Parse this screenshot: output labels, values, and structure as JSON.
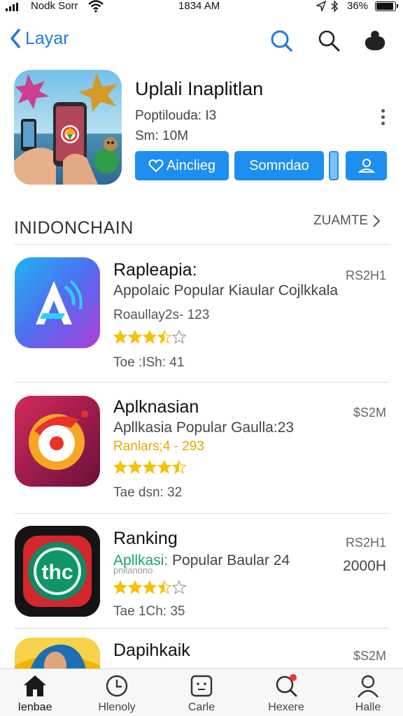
{
  "status_bar": {
    "carrier": "Nodk Sorr",
    "time": "1834 AM",
    "battery": "36%",
    "battery_level": 0.85
  },
  "nav": {
    "back_label": "Layar",
    "icons": [
      "search-icon",
      "search-icon",
      "profile-blob-icon"
    ]
  },
  "featured": {
    "title": "Uplali Inaplitlan",
    "subtitle": "Poptilouda: I3",
    "size": "Sm: 10M",
    "install_label": "Ainclieg",
    "download_label": "Somndao",
    "icon": "user-icon"
  },
  "section": {
    "title": "INIDONCHAIN",
    "see_all": "ZUAMTE"
  },
  "apps": [
    {
      "name": "Rapleapia:",
      "desc": "Appolaic Popular Kiaular Cojlkkala",
      "rank": "Roaullay2s- 123",
      "rank_color": "mixed",
      "rating": 3.5,
      "price": "RS2H1",
      "meta": "Toe :ISh: 41"
    },
    {
      "name": "Aplknasian",
      "desc": "Apllkasia Popular Gaulla:23",
      "rank": "Ranlars;4 - 293",
      "rank_color": "yellow",
      "rating": 4.5,
      "price": "$S2M",
      "meta": "Tae dsn: 32"
    },
    {
      "name": "Ranking",
      "desc_highlight": "Apllkasi:",
      "desc": "Popular Baular 24",
      "desc_sub": "pnilanono",
      "rating": 3.5,
      "price": "RS2H1",
      "price_sub": "2000H",
      "meta": "Tae 1Ch: 35"
    },
    {
      "name": "Dapihkaik",
      "price": "$S2M"
    }
  ],
  "tabs": [
    {
      "label": "Ienbae",
      "icon": "home-icon"
    },
    {
      "label": "Hlenoly",
      "icon": "clock-icon"
    },
    {
      "label": "Carle",
      "icon": "game-face-icon"
    },
    {
      "label": "Hexere",
      "icon": "search-icon"
    },
    {
      "label": "Halle",
      "icon": "person-icon"
    }
  ],
  "colors": {
    "accent": "#1e8ff0",
    "link": "#1e7be0",
    "star": "#f4c20d"
  }
}
